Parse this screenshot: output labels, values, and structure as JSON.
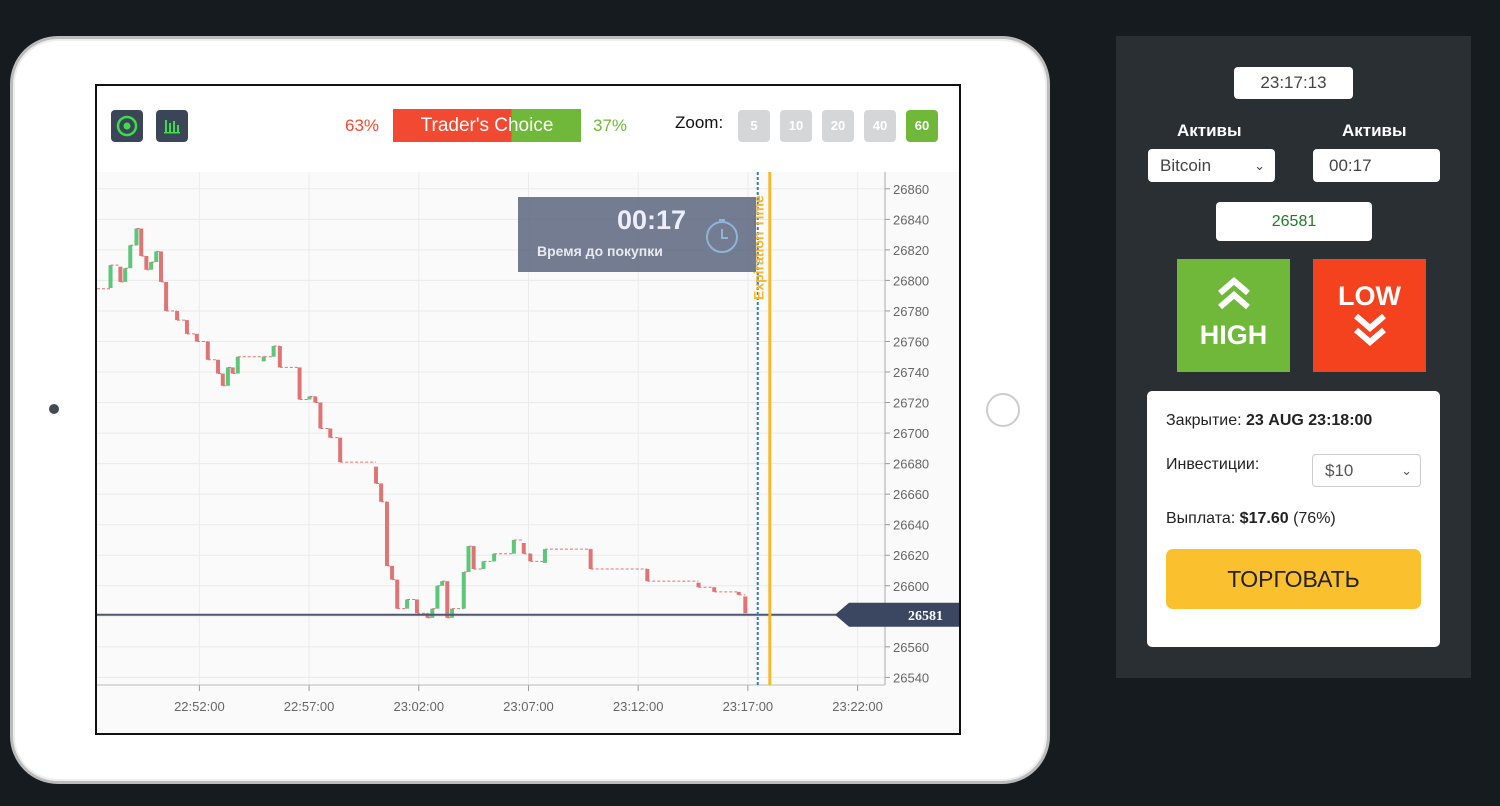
{
  "toolbar": {
    "icons": [
      "target-icon",
      "bar-chart-icon"
    ],
    "sell_percent": "63%",
    "buy_percent": "37%",
    "sell_share": 63,
    "traders_choice": "Trader's Choice",
    "zoom_label": "Zoom:",
    "zoom_options": [
      "5",
      "10",
      "20",
      "40",
      "60"
    ],
    "zoom_active": "60"
  },
  "countdown": {
    "time": "00:17",
    "label": "Время до покупки",
    "icon": "stopwatch-icon"
  },
  "expiration_label": "Expiration Time",
  "current_price_label": "26581",
  "colors": {
    "up": "#5cc77a",
    "down": "#e07474",
    "expiry": "#f5b82e",
    "now": "#3a7bbf",
    "sell": "#f24a32",
    "buy": "#6fb83a"
  },
  "chart_data": {
    "type": "candlestick",
    "xlim": [
      "22:47:20",
      "23:23:15"
    ],
    "ylim": [
      26535,
      26871
    ],
    "x_ticks": [
      "22:52:00",
      "22:57:00",
      "23:02:00",
      "23:07:00",
      "23:12:00",
      "23:17:00",
      "23:22:00"
    ],
    "y_ticks": [
      26540,
      26560,
      26580,
      26600,
      26620,
      26640,
      26660,
      26680,
      26700,
      26720,
      26740,
      26760,
      26780,
      26800,
      26820,
      26840,
      26860
    ],
    "grid": true,
    "start_price": 26794.5,
    "current_price": 26581,
    "now_time": "23:17:27",
    "expiry_time": "23:18:00",
    "candles": [
      [
        "22:47:57",
        26795,
        26810
      ],
      [
        "22:48:24",
        26809,
        26799
      ],
      [
        "22:48:37",
        26799,
        26808
      ],
      [
        "22:48:51",
        26808,
        26823
      ],
      [
        "22:49:08",
        26823,
        26834
      ],
      [
        "22:49:21",
        26834,
        26816
      ],
      [
        "22:49:35",
        26816,
        26807
      ],
      [
        "22:49:48",
        26807,
        26812
      ],
      [
        "22:50:02",
        26812,
        26819
      ],
      [
        "22:50:15",
        26819,
        26799
      ],
      [
        "22:50:29",
        26799,
        26780
      ],
      [
        "22:50:59",
        26780,
        26774
      ],
      [
        "22:51:26",
        26774,
        26765
      ],
      [
        "22:51:53",
        26765,
        26760
      ],
      [
        "22:52:23",
        26760,
        26748
      ],
      [
        "22:52:51",
        26748,
        26739
      ],
      [
        "22:53:04",
        26739,
        26731
      ],
      [
        "22:53:18",
        26731,
        26743
      ],
      [
        "22:53:31",
        26743,
        26739
      ],
      [
        "22:53:45",
        26739,
        26750
      ],
      [
        "22:54:56",
        26747,
        26750
      ],
      [
        "22:55:23",
        26750,
        26757
      ],
      [
        "22:55:40",
        26757,
        26743
      ],
      [
        "22:56:34",
        26743,
        26722
      ],
      [
        "22:57:01",
        26722,
        26724
      ],
      [
        "22:57:17",
        26724,
        26720
      ],
      [
        "22:57:31",
        26720,
        26703
      ],
      [
        "22:57:58",
        26703,
        26697
      ],
      [
        "22:58:25",
        26697,
        26681
      ],
      [
        "23:00:03",
        26678,
        26667
      ],
      [
        "23:00:17",
        26667,
        26655
      ],
      [
        "23:00:33",
        26655,
        26613
      ],
      [
        "23:00:47",
        26613,
        26604
      ],
      [
        "23:01:01",
        26604,
        26585
      ],
      [
        "23:01:28",
        26585,
        26591
      ],
      [
        "23:01:55",
        26591,
        26582
      ],
      [
        "23:02:24",
        26582,
        26579
      ],
      [
        "23:02:37",
        26579,
        26585
      ],
      [
        "23:02:51",
        26585,
        26600
      ],
      [
        "23:03:04",
        26600,
        26603
      ],
      [
        "23:03:18",
        26603,
        26579
      ],
      [
        "23:03:31",
        26579,
        26585
      ],
      [
        "23:04:03",
        26585,
        26609
      ],
      [
        "23:04:16",
        26609,
        26626
      ],
      [
        "23:04:30",
        26626,
        26611
      ],
      [
        "23:04:57",
        26611,
        26616
      ],
      [
        "23:05:26",
        26616,
        26621
      ],
      [
        "23:06:20",
        26621,
        26630
      ],
      [
        "23:06:47",
        26628,
        26621
      ],
      [
        "23:07:05",
        26621,
        26616
      ],
      [
        "23:07:45",
        26615,
        26624
      ],
      [
        "23:09:50",
        26624,
        26611
      ],
      [
        "23:12:25",
        26611,
        26603
      ],
      [
        "23:14:45",
        26602,
        26599
      ],
      [
        "23:15:28",
        26599,
        26596
      ],
      [
        "23:16:35",
        26596,
        26594
      ],
      [
        "23:16:53",
        26593,
        26582
      ]
    ]
  },
  "panel": {
    "clock": "23:17:13",
    "asset_label": "Активы",
    "asset_value": "Bitcoin",
    "time_label": "Активы",
    "time_value": "00:17",
    "price": "26581",
    "high_label": "HIGH",
    "low_label": "LOW",
    "close_label": "Закрытие:",
    "close_value": "23 AUG 23:18:00",
    "invest_label": "Инвестиции:",
    "invest_value": "$10",
    "payout_label": "Выплата:",
    "payout_value": "$17.60",
    "payout_percent": "(76%)",
    "trade_label": "ТОРГОВАТЬ"
  }
}
